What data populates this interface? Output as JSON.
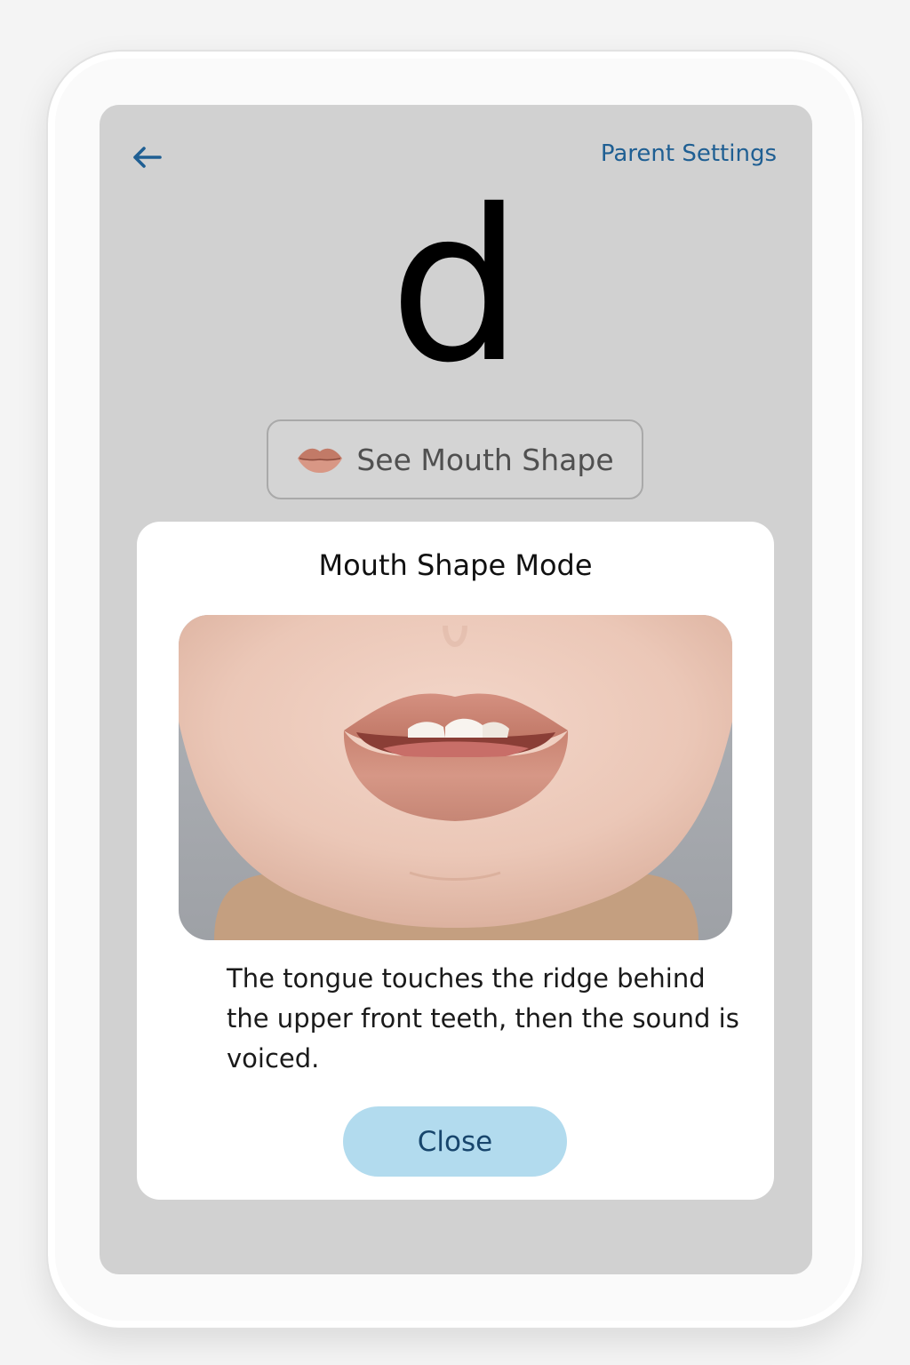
{
  "header": {
    "back_icon": "arrow-left-icon",
    "settings_label": "Parent Settings"
  },
  "lesson": {
    "letter": "d"
  },
  "mouth_button": {
    "icon": "lips-icon",
    "label": "See Mouth Shape"
  },
  "modal": {
    "title": "Mouth Shape Mode",
    "image": "close-up photo of lips with tongue touching ridge behind upper teeth",
    "description": "The tongue touches the ridge behind the upper front teeth, then the sound is voiced.",
    "close_label": "Close"
  },
  "colors": {
    "accent": "#1f5f93",
    "screen_bg": "#d1d1d1",
    "close_button_bg": "#b2dbee"
  }
}
